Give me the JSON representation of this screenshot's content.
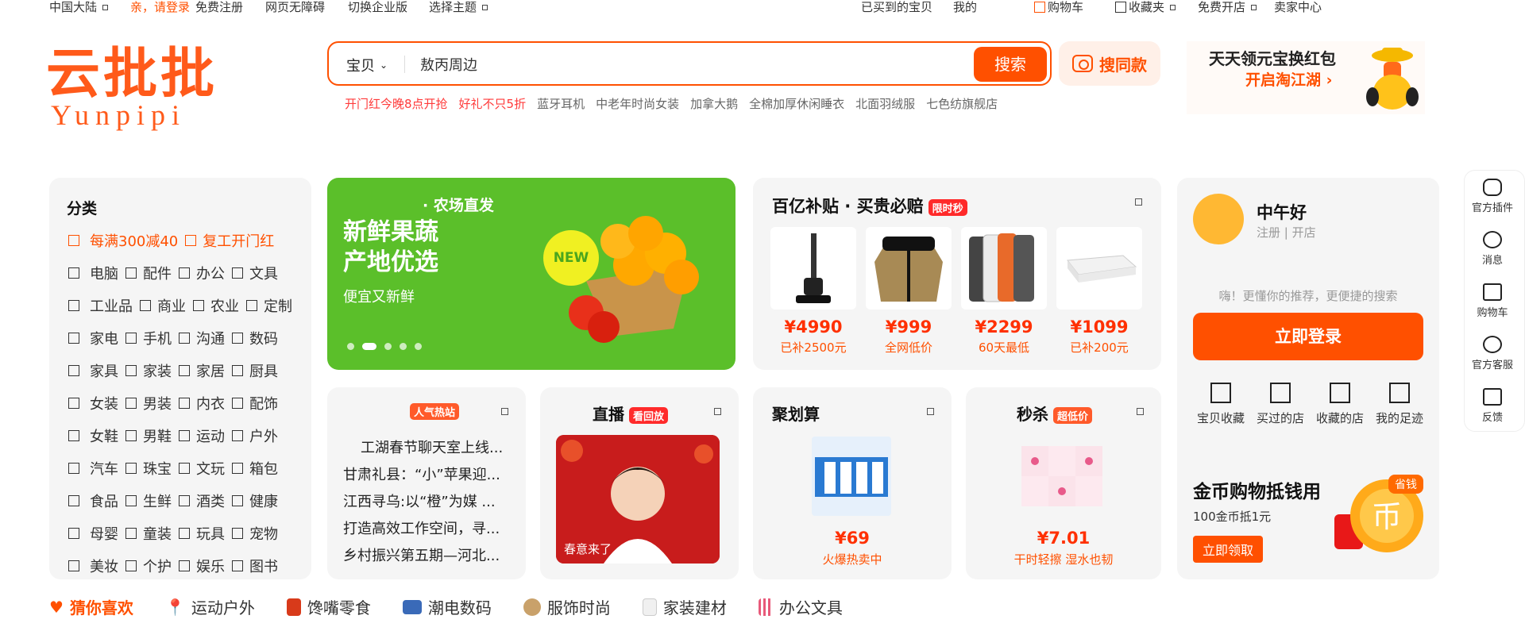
{
  "topbar": {
    "region": "中国大陆",
    "login": "亲，请登录",
    "register": "免费注册",
    "accessible": "网页无障碍",
    "enterprise": "切换企业版",
    "theme": "选择主题",
    "bought": "已买到的宝贝",
    "my": "我的",
    "cart": "购物车",
    "favorites": "收藏夹",
    "open_store": "免费开店",
    "seller": "卖家中心"
  },
  "logo": {
    "zh": "云批批",
    "en": "Yunpipi"
  },
  "search": {
    "type": "宝贝",
    "query": "敖丙周边",
    "button": "搜索",
    "image_search": "搜同款"
  },
  "hot_searches": [
    "开门红今晚8点开抢",
    "好礼不只5折",
    "蓝牙耳机",
    "中老年时尚女装",
    "加拿大鹅",
    "全棉加厚休闲睡衣",
    "北面羽绒服",
    "七色纺旗舰店"
  ],
  "promo": {
    "line1": "天天领元宝换红包",
    "line2": "开启淘江湖 ›"
  },
  "categories": {
    "title": "分类",
    "rows": [
      [
        "每满300减40",
        "复工开门红"
      ],
      [
        "电脑",
        "配件",
        "办公",
        "文具"
      ],
      [
        "工业品",
        "商业",
        "农业",
        "定制"
      ],
      [
        "家电",
        "手机",
        "沟通",
        "数码"
      ],
      [
        "家具",
        "家装",
        "家居",
        "厨具"
      ],
      [
        "女装",
        "男装",
        "内衣",
        "配饰"
      ],
      [
        "女鞋",
        "男鞋",
        "运动",
        "户外"
      ],
      [
        "汽车",
        "珠宝",
        "文玩",
        "箱包"
      ],
      [
        "食品",
        "生鲜",
        "酒类",
        "健康"
      ],
      [
        "母婴",
        "童装",
        "玩具",
        "宠物"
      ],
      [
        "美妆",
        "个护",
        "娱乐",
        "图书"
      ]
    ]
  },
  "banner": {
    "subtitle": "· 农场直发",
    "title1": "新鲜果蔬",
    "title2": "产地优选",
    "tagline": "便宜又新鲜",
    "badge": "NEW"
  },
  "subsidy": {
    "title": "百亿补贴 · 买贵必赔",
    "tag": "限时秒",
    "products": [
      {
        "price": "¥4990",
        "note": "已补2500元"
      },
      {
        "price": "¥999",
        "note": "全网低价"
      },
      {
        "price": "¥2299",
        "note": "60天最低"
      },
      {
        "price": "¥1099",
        "note": "已补200元"
      }
    ]
  },
  "user": {
    "greeting": "中午好",
    "register": "注册",
    "open_store": "开店",
    "hint": "嗨！更懂你的推荐，更便捷的搜索",
    "login": "立即登录",
    "quick": [
      "宝贝收藏",
      "买过的店",
      "收藏的店",
      "我的足迹"
    ],
    "coin_title": "金币购物抵钱用",
    "coin_sub": "100金币抵1元",
    "coin_btn": "立即领取",
    "coin_tag": "省钱"
  },
  "hot_news": {
    "tag": "人气热站",
    "items": [
      "工湖春节聊天室上线...",
      "甘肃礼县：“小”苹果迎...",
      "江西寻乌:以“橙”为媒 ...",
      "打造高效工作空间，寻...",
      "乡村振兴第五期—河北..."
    ]
  },
  "live": {
    "title": "直播",
    "tag": "看回放",
    "caption": "春意来了"
  },
  "juhuasuan": {
    "title": "聚划算",
    "price": "¥69",
    "note": "火爆热卖中"
  },
  "flash": {
    "title": "秒杀",
    "tag": "超低价",
    "price": "¥7.01",
    "note": "干时轻擦 湿水也韧"
  },
  "sidebar": [
    "官方插件",
    "消息",
    "购物车",
    "官方客服",
    "反馈"
  ],
  "bottom_tabs": [
    "猜你喜欢",
    "运动户外",
    "馋嘴零食",
    "潮电数码",
    "服饰时尚",
    "家装建材",
    "办公文具"
  ]
}
